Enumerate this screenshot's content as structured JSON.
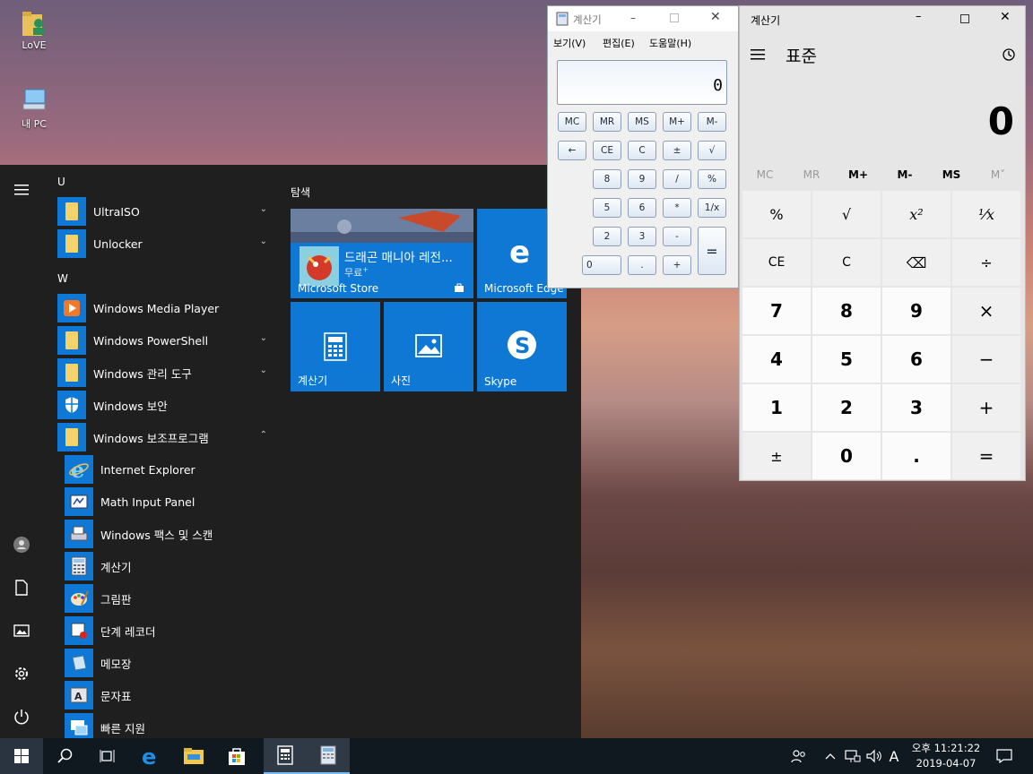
{
  "desktop": {
    "icons": [
      {
        "label": "LoVE",
        "icon": "user-folder-icon"
      },
      {
        "label": "내 PC",
        "icon": "this-pc-icon"
      }
    ]
  },
  "start_menu": {
    "sections": {
      "u": "U",
      "w": "W"
    },
    "apps": [
      {
        "label": "UltraISO",
        "icon": "folder-icon",
        "expandable": true
      },
      {
        "label": "Unlocker",
        "icon": "folder-icon",
        "expandable": true
      },
      {
        "label": "Windows Media Player",
        "icon": "media-player-icon"
      },
      {
        "label": "Windows PowerShell",
        "icon": "folder-icon",
        "expandable": true
      },
      {
        "label": "Windows 관리 도구",
        "icon": "folder-icon",
        "expandable": true
      },
      {
        "label": "Windows 보안",
        "icon": "shield-icon"
      },
      {
        "label": "Windows 보조프로그램",
        "icon": "folder-icon",
        "expanded": true
      },
      {
        "label": "Internet Explorer",
        "icon": "ie-icon"
      },
      {
        "label": "Math Input Panel",
        "icon": "math-input-icon"
      },
      {
        "label": "Windows 팩스 및 스캔",
        "icon": "fax-scan-icon"
      },
      {
        "label": "계산기",
        "icon": "calculator-icon"
      },
      {
        "label": "그림판",
        "icon": "paint-icon"
      },
      {
        "label": "단계 레코더",
        "icon": "steps-recorder-icon"
      },
      {
        "label": "메모장",
        "icon": "notepad-icon"
      },
      {
        "label": "문자표",
        "icon": "charmap-icon"
      },
      {
        "label": "빠른 지원",
        "icon": "quick-assist-icon"
      }
    ],
    "tiles_header": "탐색",
    "tiles": {
      "store": {
        "title": "드래곤 매니아 레전...",
        "price": "무료",
        "label": "Microsoft Store"
      },
      "edge": {
        "label": "Microsoft Edge"
      },
      "calculator": {
        "label": "계산기"
      },
      "photos": {
        "label": "사진"
      },
      "skype": {
        "label": "Skype"
      }
    }
  },
  "old_calculator": {
    "title": "계산기",
    "menu": [
      "보기(V)",
      "편집(E)",
      "도움말(H)"
    ],
    "display": "0",
    "rows": [
      [
        "MC",
        "MR",
        "MS",
        "M+",
        "M-"
      ],
      [
        "←",
        "CE",
        "C",
        "±",
        "√"
      ],
      [
        "",
        "8",
        "9",
        "/",
        "%"
      ],
      [
        "",
        "5",
        "6",
        "*",
        "1/x"
      ],
      [
        "",
        "2",
        "3",
        "-",
        "="
      ],
      [
        "0",
        ".",
        "+"
      ]
    ]
  },
  "new_calculator": {
    "title": "계산기",
    "mode": "표준",
    "display": "0",
    "memory": [
      "MC",
      "MR",
      "M+",
      "M-",
      "MS",
      "M˅"
    ],
    "keys": [
      [
        "%",
        "√",
        "x²",
        "¹⁄x"
      ],
      [
        "CE",
        "C",
        "⌫",
        "÷"
      ],
      [
        "7",
        "8",
        "9",
        "×"
      ],
      [
        "4",
        "5",
        "6",
        "−"
      ],
      [
        "1",
        "2",
        "3",
        "+"
      ],
      [
        "±",
        "0",
        ".",
        "="
      ]
    ]
  },
  "taskbar": {
    "ime": "A",
    "time": "오후 11:21:22",
    "date": "2019-04-07"
  },
  "colors": {
    "accent": "#0e78d4",
    "start_bg": "#1f1f1f",
    "taskbar_bg": "#101820"
  }
}
